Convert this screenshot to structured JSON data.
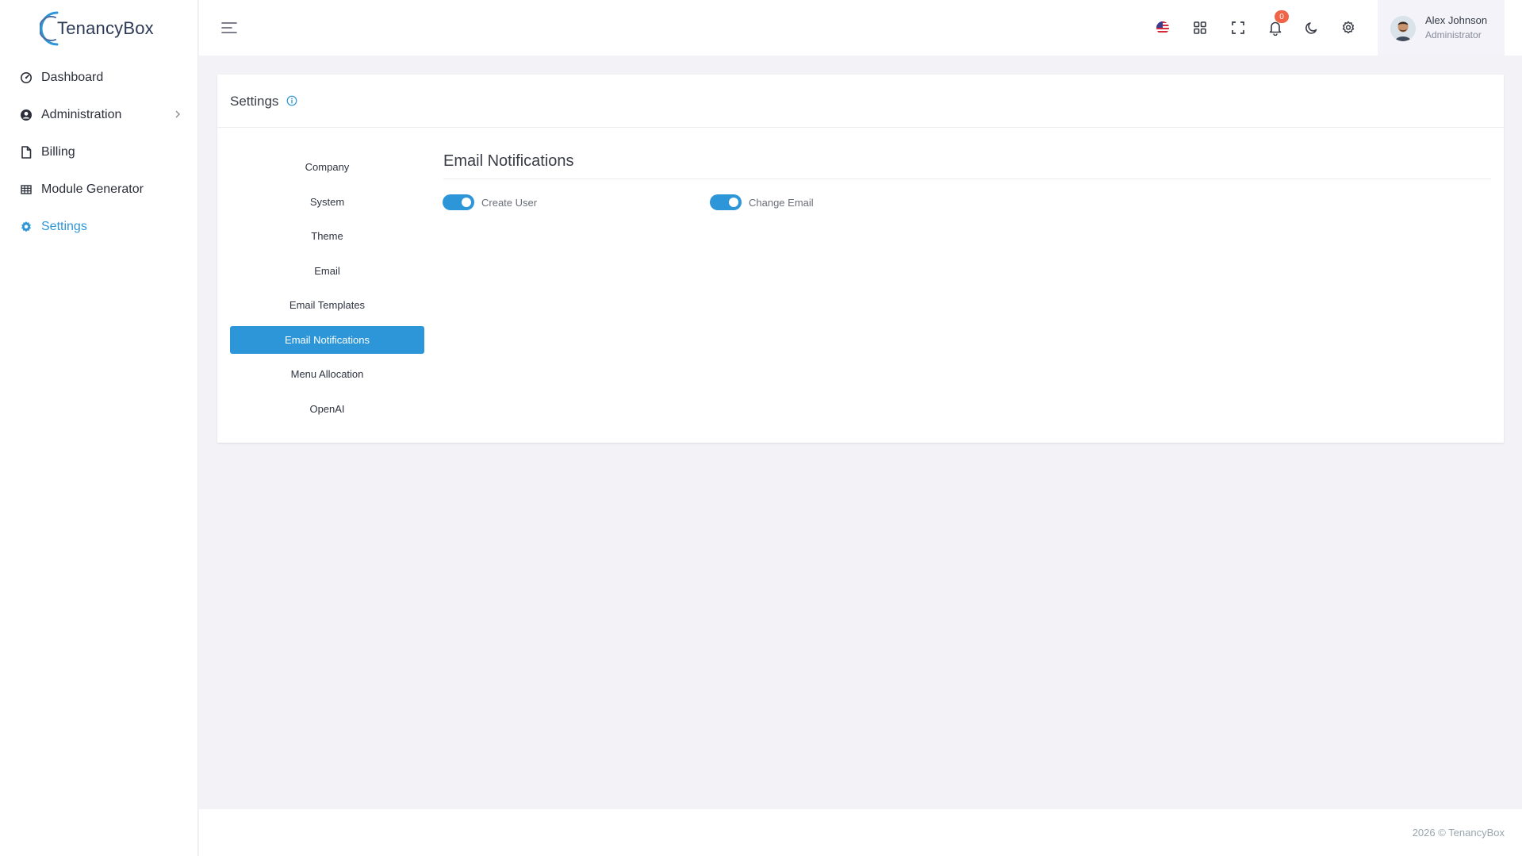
{
  "brand": {
    "name": "TenancyBox",
    "accent": "#2d96d8"
  },
  "sidebar": {
    "items": [
      {
        "label": "Dashboard",
        "icon": "speedometer-icon"
      },
      {
        "label": "Administration",
        "icon": "user-circle-icon"
      },
      {
        "label": "Billing",
        "icon": "file-icon"
      },
      {
        "label": "Module Generator",
        "icon": "grid-table-icon"
      },
      {
        "label": "Settings",
        "icon": "gear-icon"
      }
    ],
    "active": "Settings"
  },
  "topbar": {
    "notifications_count": "0",
    "user": {
      "name": "Alex Johnson",
      "role": "Administrator"
    }
  },
  "card": {
    "title": "Settings",
    "menu": [
      "Company",
      "System",
      "Theme",
      "Email",
      "Email Templates",
      "Email Notifications",
      "Menu Allocation",
      "OpenAI"
    ],
    "active_menu": "Email Notifications",
    "section_title": "Email Notifications",
    "toggles": [
      {
        "label": "Create User",
        "on": true
      },
      {
        "label": "Change Email",
        "on": true
      }
    ]
  },
  "footer": {
    "text": "2026 © TenancyBox"
  }
}
